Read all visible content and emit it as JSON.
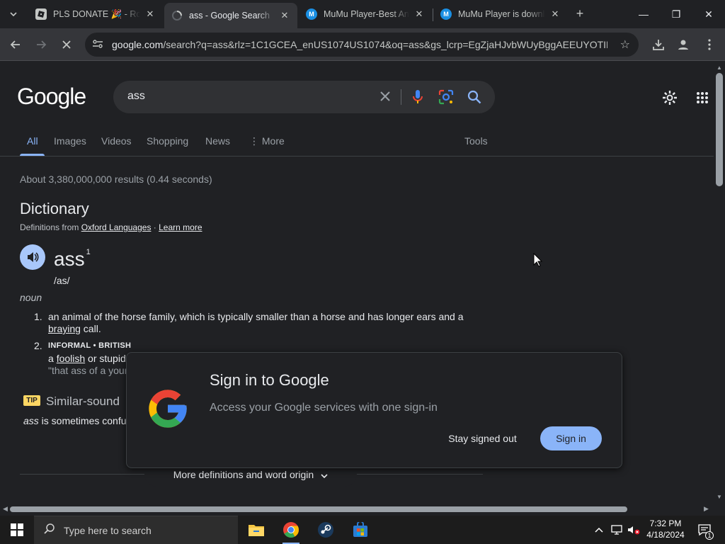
{
  "tabs": [
    {
      "title": "PLS DONATE 🎉 - Roblox",
      "close": "✕"
    },
    {
      "title": "ass - Google Search",
      "close": "✕"
    },
    {
      "title": "MuMu Player-Best Android Emulator",
      "close": "✕"
    },
    {
      "title": "MuMu Player is downloading",
      "close": "✕"
    }
  ],
  "window": {
    "new_tab": "+",
    "minimize": "—",
    "restore": "❐",
    "close": "✕"
  },
  "toolbar": {
    "url_host": "google.com",
    "url_rest": "/search?q=ass&rlz=1C1GCEA_enUS1074US1074&oq=ass&gs_lcrp=EgZjaHJvbWUyBggAEEUYOTIHCA..."
  },
  "search": {
    "query": "ass"
  },
  "search_tabs": [
    "All",
    "Images",
    "Videos",
    "Shopping",
    "News",
    "More"
  ],
  "tools_label": "Tools",
  "results": {
    "stats": "About 3,380,000,000 results (0.44 seconds)"
  },
  "dictionary": {
    "title": "Dictionary",
    "source_prefix": "Definitions from ",
    "source_link": "Oxford Languages",
    "sep": " · ",
    "learn_more": "Learn more",
    "word": "ass",
    "superscript": "1",
    "phonetic": "/as/",
    "part_of_speech": "noun",
    "def1_num": "1.",
    "def1_text": "an animal of the horse family, which is typically smaller than a horse and has longer ears and a",
    "def1_link": "braying",
    "def1_end": " call.",
    "def2_num": "2.",
    "def2_tag": "INFORMAL • BRITISH",
    "def2_a": "a ",
    "def2_link": "foolish",
    "def2_rest": " or stupid",
    "def2_example": "\"that ass of a your",
    "tip_badge": "TIP",
    "tip_title": "Similar-sound",
    "tip_word": "ass",
    "tip_rest": " is sometimes confu",
    "more": "More definitions and word origin"
  },
  "signin": {
    "title": "Sign in to Google",
    "body": "Access your Google services with one sign-in",
    "stay": "Stay signed out",
    "sign_in": "Sign in"
  },
  "taskbar": {
    "search_placeholder": "Type here to search",
    "time": "7:32 PM",
    "date": "4/18/2024",
    "notif_count": "1"
  },
  "colors": {
    "accent": "#8ab4f8",
    "background": "#202124",
    "surface": "#303134"
  }
}
